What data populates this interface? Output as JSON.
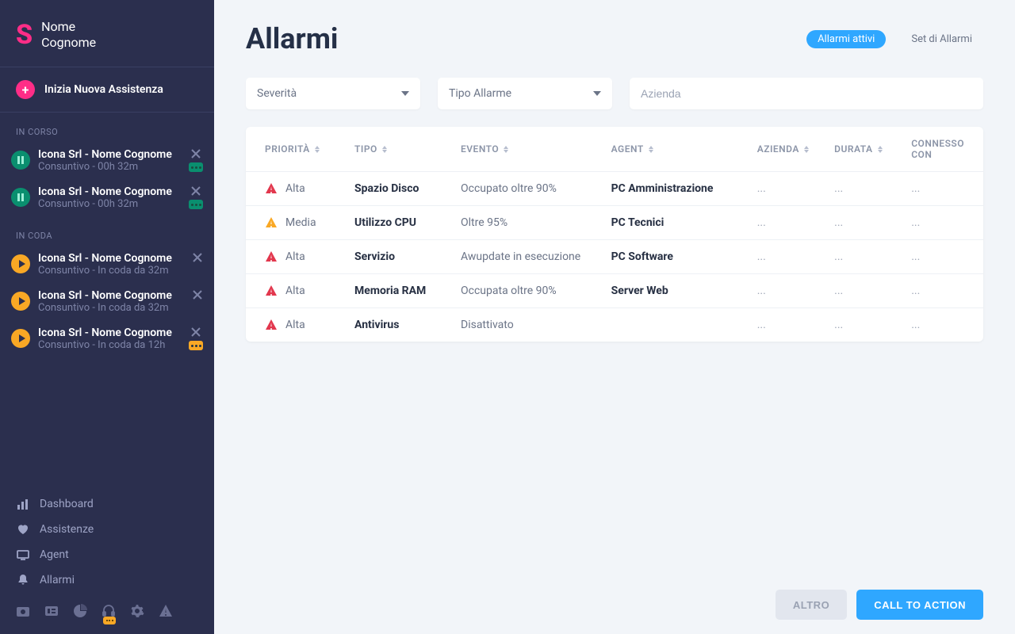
{
  "user": {
    "first": "Nome",
    "last": "Cognome"
  },
  "sidebar": {
    "start_label": "Inizia Nuova Assistenza",
    "sections": {
      "in_corso": "In Corso",
      "in_coda": "In Coda"
    },
    "sessions_in_corso": [
      {
        "title": "Icona Srl - Nome Cognome",
        "subtitle": "Consuntivo - 00h 32m"
      },
      {
        "title": "Icona Srl - Nome Cognome",
        "subtitle": "Consuntivo - 00h 32m"
      }
    ],
    "sessions_in_coda": [
      {
        "title": "Icona Srl - Nome Cognome",
        "subtitle": "Consuntivo - In coda da 32m",
        "badge": null
      },
      {
        "title": "Icona Srl - Nome Cognome",
        "subtitle": "Consuntivo - In coda da 32m",
        "badge": null
      },
      {
        "title": "Icona Srl - Nome Cognome",
        "subtitle": "Consuntivo - In coda da 12h",
        "badge": "yellow"
      }
    ],
    "nav": [
      {
        "label": "Dashboard",
        "icon": "bars"
      },
      {
        "label": "Assistenze",
        "icon": "heart"
      },
      {
        "label": "Agent",
        "icon": "monitor"
      },
      {
        "label": "Allarmi",
        "icon": "bell"
      }
    ]
  },
  "page": {
    "title": "Allarmi",
    "tabs": {
      "active": "Allarmi attivi",
      "ghost": "Set di Allarmi"
    }
  },
  "filters": {
    "severity_label": "Severità",
    "type_label": "Tipo Allarme",
    "company_placeholder": "Azienda"
  },
  "table": {
    "columns": [
      "Priorità",
      "Tipo",
      "Evento",
      "Agent",
      "Azienda",
      "Durata",
      "Connesso con"
    ],
    "rows": [
      {
        "severity": "Alta",
        "sev_color": "#e2374d",
        "tipo": "Spazio Disco",
        "evento": "Occupato oltre 90%",
        "agent": "PC Amministrazione",
        "azienda": "...",
        "durata": "...",
        "connesso": "..."
      },
      {
        "severity": "Media",
        "sev_color": "#f9a825",
        "tipo": "Utilizzo CPU",
        "evento": "Oltre 95%",
        "agent": "PC Tecnici",
        "azienda": "...",
        "durata": "...",
        "connesso": "..."
      },
      {
        "severity": "Alta",
        "sev_color": "#e2374d",
        "tipo": "Servizio",
        "evento": "Awupdate in esecuzione",
        "agent": "PC Software",
        "azienda": "...",
        "durata": "...",
        "connesso": "..."
      },
      {
        "severity": "Alta",
        "sev_color": "#e2374d",
        "tipo": "Memoria RAM",
        "evento": "Occupata oltre 90%",
        "agent": "Server Web",
        "azienda": "...",
        "durata": "...",
        "connesso": "..."
      },
      {
        "severity": "Alta",
        "sev_color": "#e2374d",
        "tipo": "Antivirus",
        "evento": "Disattivato",
        "agent": "",
        "azienda": "...",
        "durata": "...",
        "connesso": "..."
      }
    ]
  },
  "actions": {
    "secondary": "ALTRO",
    "primary": "CALL TO ACTION"
  }
}
